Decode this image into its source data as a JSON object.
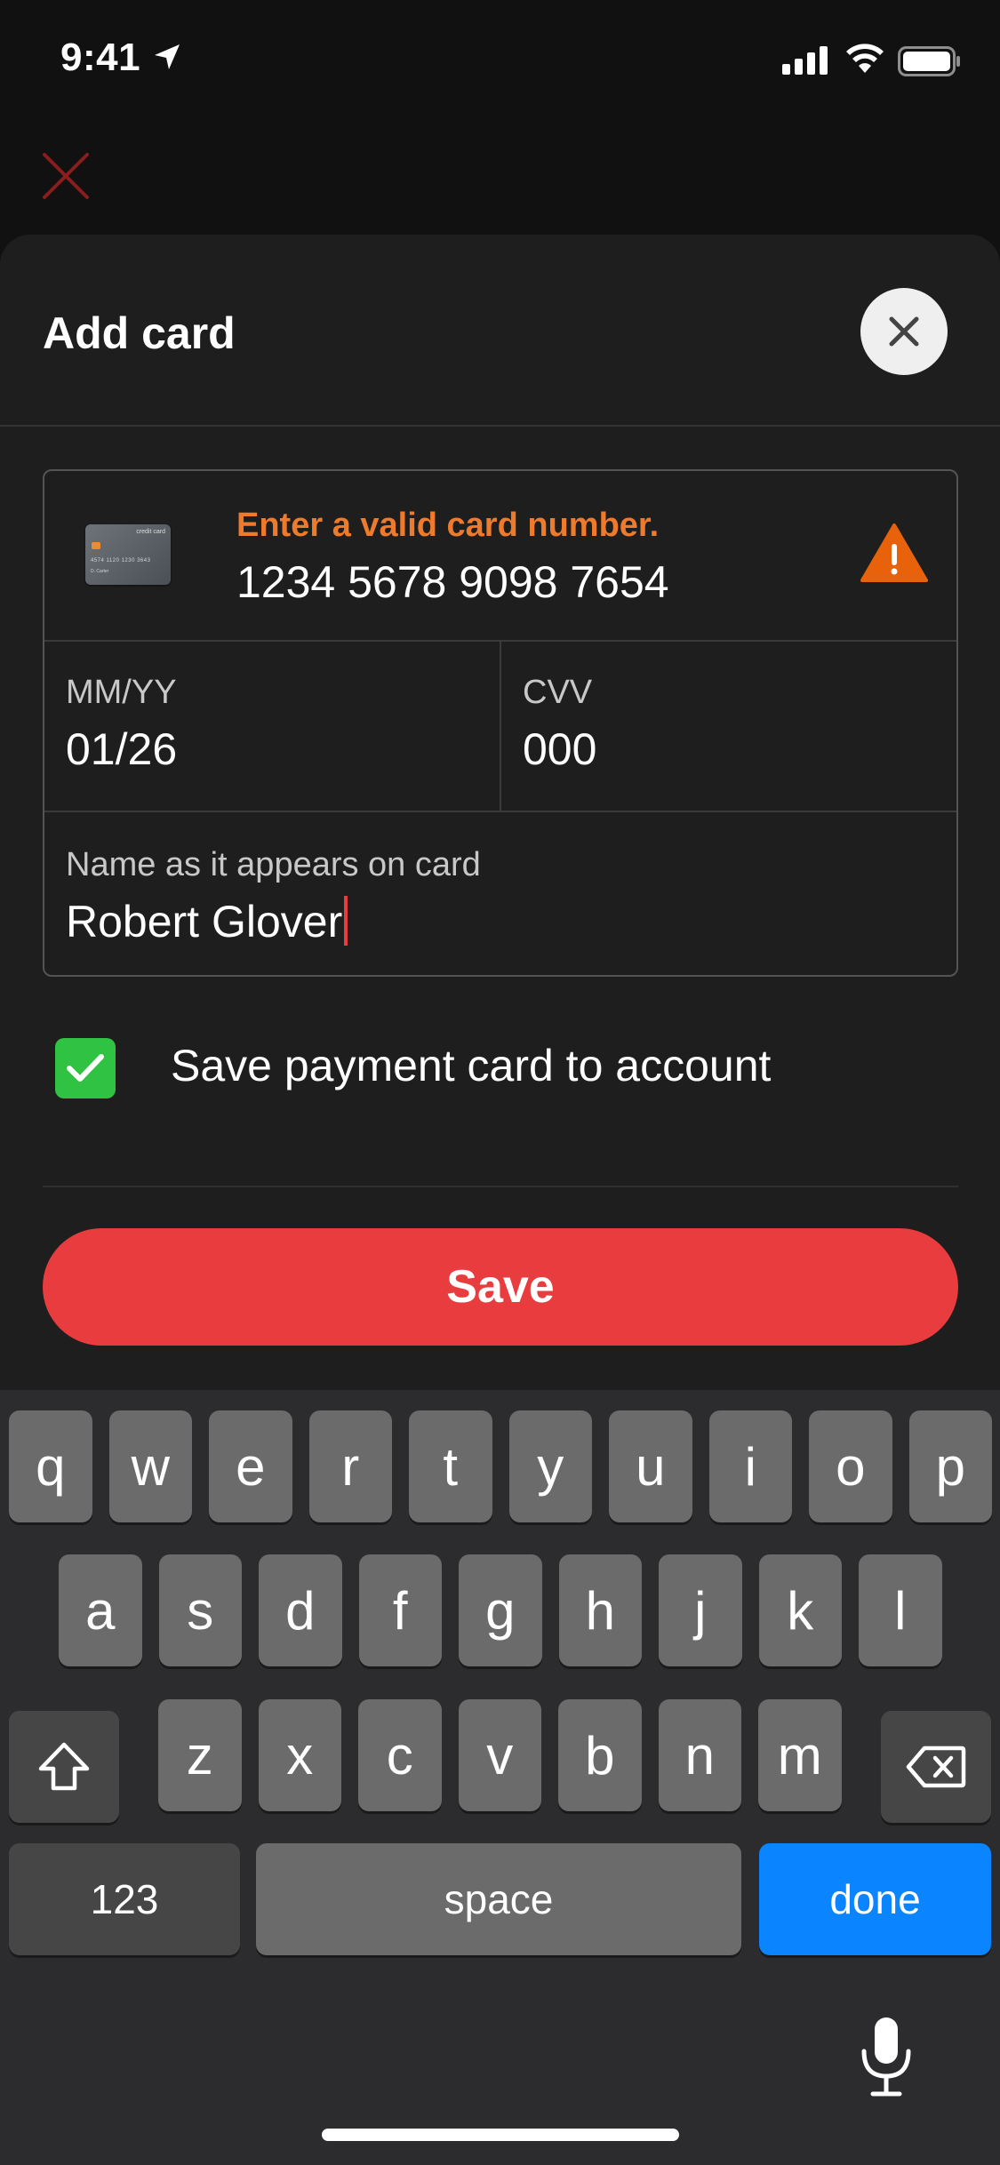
{
  "status_bar": {
    "time": "9:41",
    "icons": [
      "location-arrow-icon",
      "signal-icon",
      "wifi-icon",
      "battery-icon"
    ]
  },
  "sheet": {
    "title": "Add card",
    "close_icon": "close-icon"
  },
  "card_form": {
    "card_number": {
      "error": "Enter a valid card number.",
      "value": "1234 5678 9098 7654",
      "card_image_text": "credit card",
      "card_image_number": "4574 1120 1230 3643",
      "card_image_name": "D. Carter",
      "error_color": "#EE7A2C"
    },
    "expiry": {
      "label": "MM/YY",
      "value": "01/26"
    },
    "cvv": {
      "label": "CVV",
      "value": "000"
    },
    "name": {
      "label": "Name as it appears on card",
      "value": "Robert Glover"
    }
  },
  "save_to_account": {
    "checked": true,
    "label": "Save payment card to account",
    "check_color": "#2FC243"
  },
  "save_button": {
    "label": "Save",
    "color": "#E93C3F"
  },
  "keyboard": {
    "row1": [
      "q",
      "w",
      "e",
      "r",
      "t",
      "y",
      "u",
      "i",
      "o",
      "p"
    ],
    "row2": [
      "a",
      "s",
      "d",
      "f",
      "g",
      "h",
      "j",
      "k",
      "l"
    ],
    "row3": [
      "z",
      "x",
      "c",
      "v",
      "b",
      "n",
      "m"
    ],
    "numbers_key": "123",
    "space_key": "space",
    "done_key": "done",
    "done_color": "#0A84FF"
  }
}
